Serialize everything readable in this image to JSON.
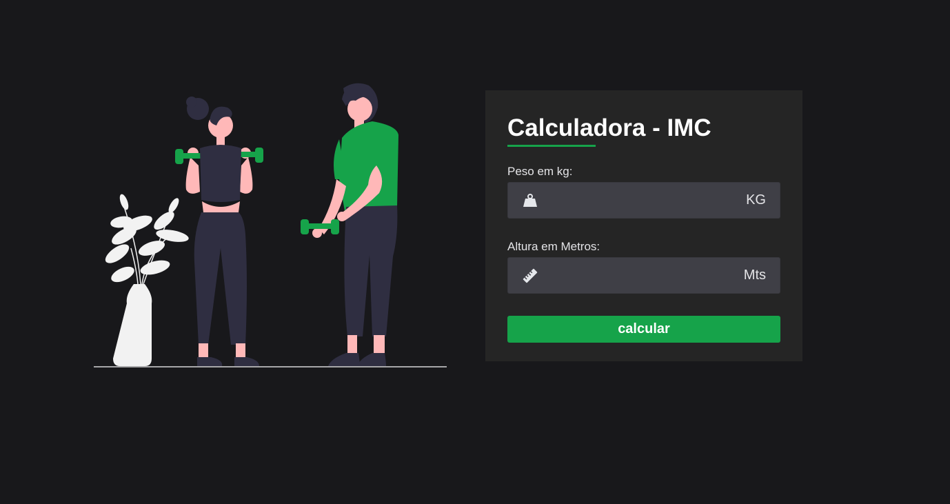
{
  "card": {
    "title": "Calculadora - IMC",
    "weight": {
      "label": "Peso em kg:",
      "unit": "KG",
      "value": "",
      "icon": "weight-icon"
    },
    "height": {
      "label": "Altura em Metros:",
      "unit": "Mts",
      "value": "",
      "icon": "ruler-icon"
    },
    "button_label": "calcular"
  },
  "colors": {
    "background": "#18181b",
    "card": "#252525",
    "input": "#3f3f46",
    "accent": "#16a34a"
  }
}
